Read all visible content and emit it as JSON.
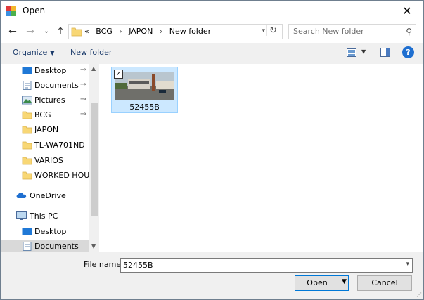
{
  "window": {
    "title": "Open",
    "close_glyph": "✕"
  },
  "nav": {
    "back_glyph": "←",
    "forward_glyph": "→",
    "recent_glyph": "⌄",
    "up_glyph": "↑",
    "address": {
      "overflow": "«",
      "crumbs": [
        "BCG",
        "JAPON",
        "New folder"
      ],
      "separator": "›"
    },
    "search_placeholder": "Search New folder"
  },
  "toolbar": {
    "organize_label": "Organize",
    "new_folder_label": "New folder",
    "help_label": "?"
  },
  "sidebar": {
    "items": [
      {
        "label": "Desktop",
        "icon": "desktop-icon",
        "pinned": true
      },
      {
        "label": "Documents",
        "icon": "documents-icon",
        "pinned": true
      },
      {
        "label": "Pictures",
        "icon": "pictures-icon",
        "pinned": true
      },
      {
        "label": "BCG",
        "icon": "folder-icon",
        "pinned": true
      },
      {
        "label": "JAPON",
        "icon": "folder-icon",
        "pinned": false
      },
      {
        "label": "TL-WA701ND",
        "icon": "folder-icon",
        "pinned": false
      },
      {
        "label": "VARIOS",
        "icon": "folder-icon",
        "pinned": false
      },
      {
        "label": "WORKED HOURS",
        "icon": "folder-icon",
        "pinned": false
      },
      {
        "label": "OneDrive",
        "icon": "onedrive-icon",
        "pinned": false
      },
      {
        "label": "This PC",
        "icon": "this-pc-icon",
        "pinned": false
      },
      {
        "label": "Desktop",
        "icon": "desktop-icon",
        "pinned": false
      },
      {
        "label": "Documents",
        "icon": "documents-icon",
        "pinned": false
      }
    ],
    "pin_glyph": "📌"
  },
  "files": [
    {
      "name": "52455B",
      "checked": true
    }
  ],
  "footer": {
    "file_name_label": "File name:",
    "file_name_value": "52455B",
    "open_label": "Open",
    "cancel_label": "Cancel"
  },
  "colors": {
    "accent": "#0078d7",
    "selection": "#cce8ff",
    "folder": "#f8d775"
  }
}
